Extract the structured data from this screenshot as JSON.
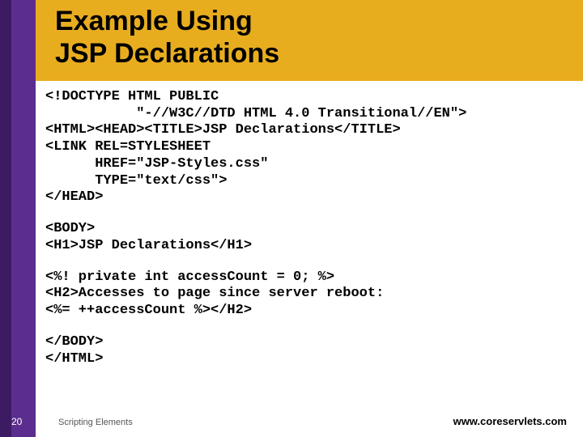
{
  "title_line1": "Example Using",
  "title_line2": "JSP Declarations",
  "code_block1": "<!DOCTYPE HTML PUBLIC\n           \"-//W3C//DTD HTML 4.0 Transitional//EN\">\n<HTML><HEAD><TITLE>JSP Declarations</TITLE>\n<LINK REL=STYLESHEET\n      HREF=\"JSP-Styles.css\"\n      TYPE=\"text/css\">\n</HEAD>",
  "code_block2": "<BODY>\n<H1>JSP Declarations</H1>",
  "code_block3": "<%! private int accessCount = 0; %>\n<H2>Accesses to page since server reboot:\n<%= ++accessCount %></H2>",
  "code_block4": "</BODY>\n</HTML>",
  "page_number": "20",
  "chapter": "Scripting Elements",
  "site": "www.coreservlets.com"
}
